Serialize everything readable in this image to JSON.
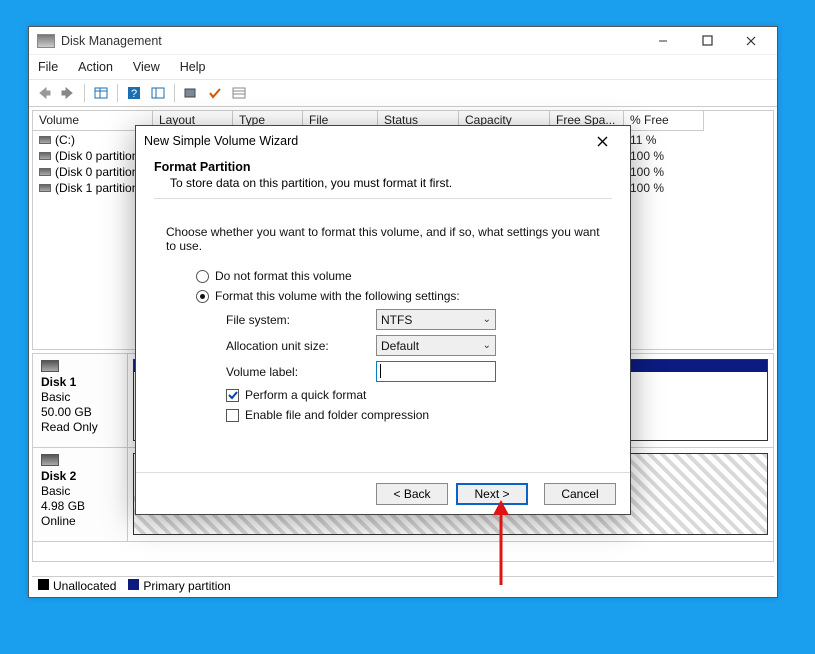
{
  "dm_window": {
    "title": "Disk Management",
    "menus": {
      "file": "File",
      "action": "Action",
      "view": "View",
      "help": "Help"
    },
    "columns": {
      "volume": "Volume",
      "layout": "Layout",
      "type": "Type",
      "fs": "File System",
      "status": "Status",
      "capacity": "Capacity",
      "freespc": "Free Spa...",
      "pctfree": "% Free"
    },
    "rows": [
      {
        "vol": "(C:)",
        "pct": "11 %"
      },
      {
        "vol": "(Disk 0 partition",
        "pct": "100 %"
      },
      {
        "vol": "(Disk 0 partition",
        "pct": "100 %"
      },
      {
        "vol": "(Disk 1 partition",
        "pct": "100 %"
      }
    ],
    "disks": [
      {
        "name": "Disk 1",
        "type": "Basic",
        "size": "50.00 GB",
        "state": "Read Only"
      },
      {
        "name": "Disk 2",
        "type": "Basic",
        "size": "4.98 GB",
        "state": "Online"
      }
    ],
    "disk2_unalloc_size": "4.98 GB",
    "disk2_unalloc_label": "Unallocated",
    "legend": {
      "unalloc": "Unallocated",
      "primary": "Primary partition"
    }
  },
  "wizard": {
    "title": "New Simple Volume Wizard",
    "heading": "Format Partition",
    "subheading": "To store data on this partition, you must format it first.",
    "desc": "Choose whether you want to format this volume, and if so, what settings you want to use.",
    "opt_noformat": "Do not format this volume",
    "opt_format": "Format this volume with the following settings:",
    "lbl_fs": "File system:",
    "val_fs": "NTFS",
    "lbl_alloc": "Allocation unit size:",
    "val_alloc": "Default",
    "lbl_label": "Volume label:",
    "val_label": "",
    "chk_quick": "Perform a quick format",
    "chk_compress": "Enable file and folder compression",
    "btn_back": "< Back",
    "btn_next": "Next >",
    "btn_cancel": "Cancel",
    "quick_checked": true,
    "compress_checked": false,
    "selected_option": "format"
  }
}
